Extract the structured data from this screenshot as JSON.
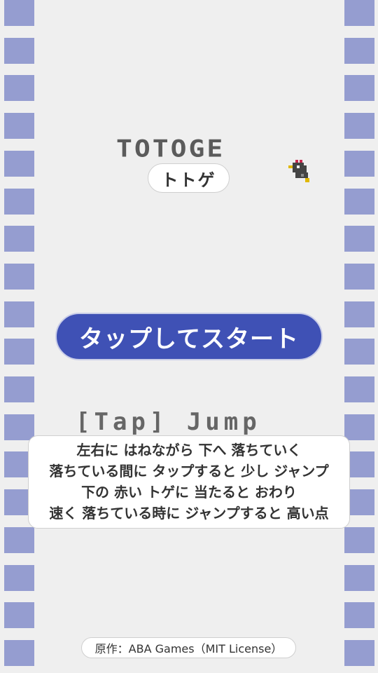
{
  "game": {
    "title": "TOTOGE",
    "subtitle": "トトゲ",
    "start_button": "タップしてスタート",
    "control_hint": "[Tap] Jump",
    "instructions": [
      "左右に はねながら 下へ 落ちていく",
      "落ちている間に タップすると 少し ジャンプ",
      "下の 赤い トゲに 当たると おわり",
      "速く 落ちている時に ジャンプすると 高い点"
    ],
    "credit": "原作：ABA Games（MIT License）"
  },
  "colors": {
    "background": "#efefef",
    "wall_tile": "#959dd0",
    "button": "#3f51b5",
    "button_text": "#ffffff"
  },
  "icons": {
    "player": "chick-icon"
  }
}
